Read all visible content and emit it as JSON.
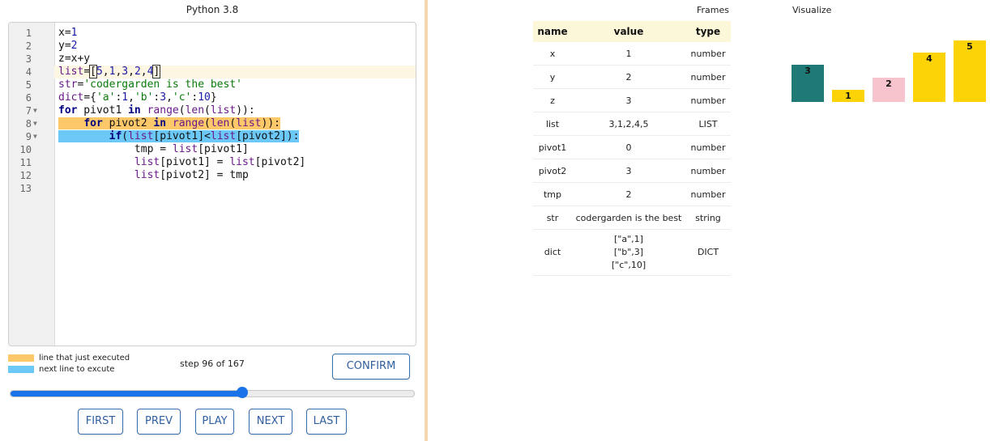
{
  "editor": {
    "language": "Python 3.8",
    "lines": [
      {
        "n": "1",
        "fold": "",
        "html": "x=<span class='num-t'>1</span>"
      },
      {
        "n": "2",
        "fold": "",
        "html": "y=<span class='num-t'>2</span>"
      },
      {
        "n": "3",
        "fold": "",
        "html": "z=x+y"
      },
      {
        "n": "4",
        "fold": "",
        "active": true,
        "html": "<span class='bi'>list</span>=<span class='cursor-box'>[</span><span class='num-t'>5</span>,<span class='num-t'>1</span>,<span class='num-t'>3</span>,<span class='num-t'>2</span>,<span class='num-t'>4</span><span class='cursor-box'>]</span>"
      },
      {
        "n": "5",
        "fold": "",
        "html": "<span class='bi'>str</span>=<span class='str'>'codergarden is the best'</span>"
      },
      {
        "n": "6",
        "fold": "",
        "html": "<span class='bi'>dict</span>={<span class='str'>'a'</span>:<span class='num-t'>1</span>,<span class='str'>'b'</span>:<span class='num-t'>3</span>,<span class='str'>'c'</span>:<span class='num-t'>10</span>}"
      },
      {
        "n": "7",
        "fold": "▼",
        "html": "<span class='kw'>for</span> pivot1 <span class='kw'>in</span> <span class='bi'>range</span>(<span class='bi'>len</span>(<span class='bi'>list</span>)):"
      },
      {
        "n": "8",
        "fold": "▼",
        "html": "<span class='hl-exec'>    <span class='kw'>for</span> pivot2 <span class='kw'>in</span> <span class='bi'>range</span>(<span class='bi'>len</span>(<span class='bi'>list</span>)):</span>"
      },
      {
        "n": "9",
        "fold": "▼",
        "html": "<span class='hl-next'>        <span class='kw'>if</span>(<span class='bi'>list</span>[pivot1]&lt;<span class='bi'>list</span>[pivot2]):</span>"
      },
      {
        "n": "10",
        "fold": "",
        "html": "            tmp = <span class='bi'>list</span>[pivot1]"
      },
      {
        "n": "11",
        "fold": "",
        "html": "            <span class='bi'>list</span>[pivot1] = <span class='bi'>list</span>[pivot2]"
      },
      {
        "n": "12",
        "fold": "",
        "html": "            <span class='bi'>list</span>[pivot2] = tmp"
      },
      {
        "n": "13",
        "fold": "",
        "html": ""
      }
    ]
  },
  "legend": {
    "executed_label": "line that just executed",
    "next_label": "next line to excute",
    "executed_color": "#fcc86a",
    "next_color": "#6cc8f6"
  },
  "controls": {
    "step_label": "step 96 of 167",
    "confirm_label": "CONFIRM",
    "first_label": "FIRST",
    "prev_label": "PREV",
    "play_label": "PLAY",
    "next_label": "NEXT",
    "last_label": "LAST",
    "slider_step": 96,
    "slider_total": 167,
    "accent_color": "#1a73e8"
  },
  "frames": {
    "title": "Frames",
    "headers": {
      "name": "name",
      "value": "value",
      "type": "type"
    },
    "rows": [
      {
        "name": "x",
        "value": "1",
        "type": "number"
      },
      {
        "name": "y",
        "value": "2",
        "type": "number"
      },
      {
        "name": "z",
        "value": "3",
        "type": "number"
      },
      {
        "name": "list",
        "value": "3,1,2,4,5",
        "type": "LIST"
      },
      {
        "name": "pivot1",
        "value": "0",
        "type": "number"
      },
      {
        "name": "pivot2",
        "value": "3",
        "type": "number"
      },
      {
        "name": "tmp",
        "value": "2",
        "type": "number"
      },
      {
        "name": "str",
        "value": "codergarden is the best",
        "type": "string"
      },
      {
        "name": "dict",
        "value": "[\"a\",1]\n[\"b\",3]\n[\"c\",10]",
        "type": "DICT",
        "multiline": true
      }
    ]
  },
  "visualize": {
    "title": "Visualize",
    "bars": [
      {
        "label": "3",
        "value": 3,
        "color": "#1f7a75"
      },
      {
        "label": "1",
        "value": 1,
        "color": "#fcd307"
      },
      {
        "label": "2",
        "value": 2,
        "color": "#f7c3cc"
      },
      {
        "label": "4",
        "value": 4,
        "color": "#fcd307"
      },
      {
        "label": "5",
        "value": 5,
        "color": "#fcd307"
      }
    ],
    "max": 5
  }
}
